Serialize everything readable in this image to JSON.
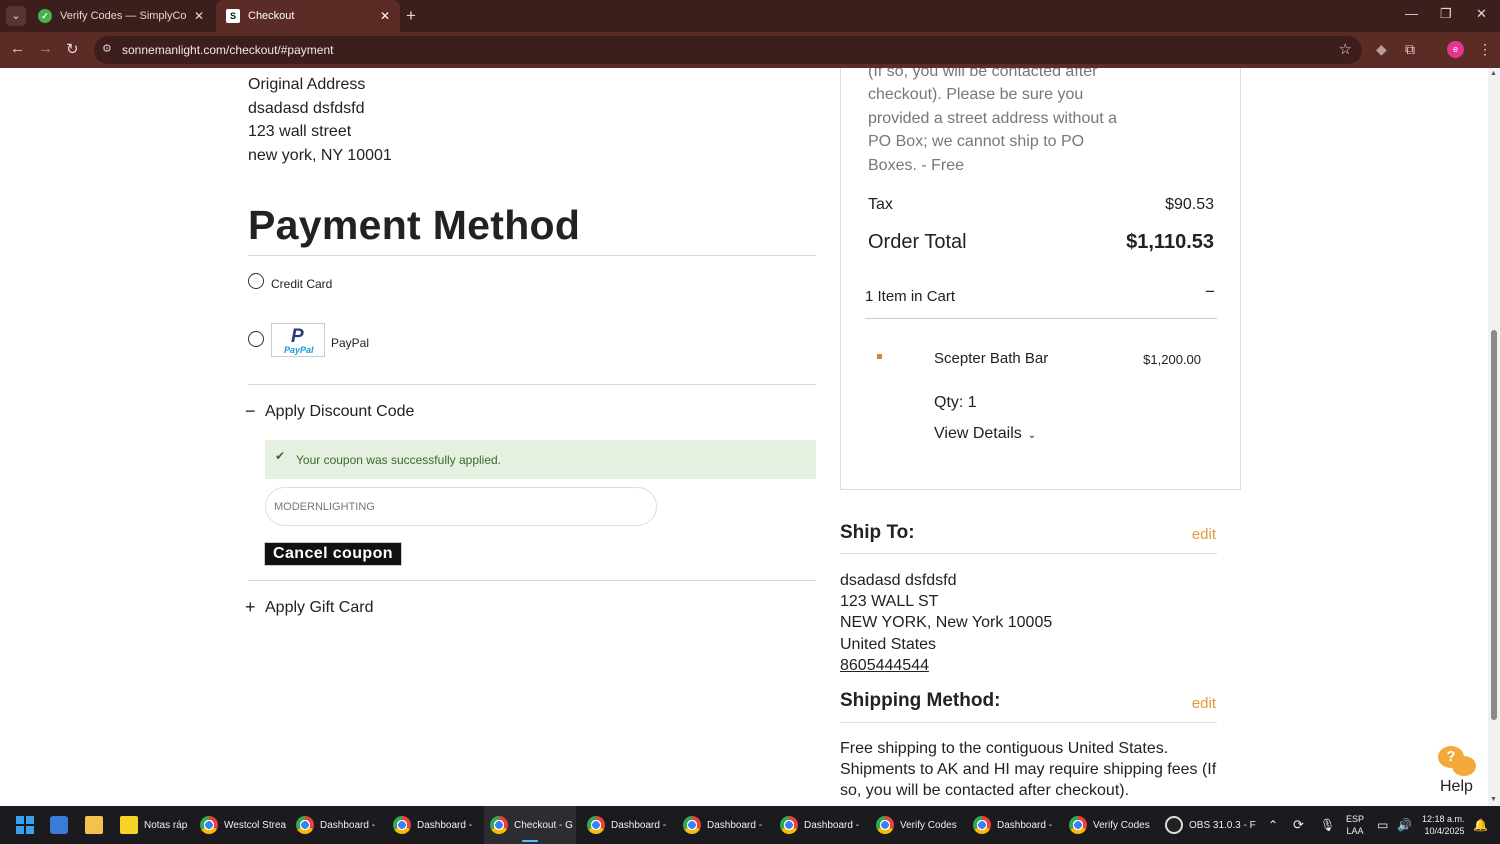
{
  "browser": {
    "tabs": [
      {
        "title": "Verify Codes — SimplyCodes",
        "active": false
      },
      {
        "title": "Checkout",
        "active": true
      }
    ],
    "url": "sonnemanlight.com/checkout/#payment"
  },
  "billing": {
    "heading": "Original Address",
    "name": "dsadasd dsfdsfd",
    "street": "123 wall street",
    "city": "new york, NY 10001"
  },
  "payment": {
    "title": "Payment Method",
    "options": [
      {
        "label": "Credit Card",
        "selected": false
      },
      {
        "label": "PayPal",
        "selected": false,
        "logo_text": "PayPal"
      }
    ],
    "discount": {
      "toggle": "−",
      "label": "Apply Discount Code",
      "success_message": "Your coupon was successfully applied.",
      "code_value": "MODERNLIGHTING",
      "cancel_label": "Cancel coupon"
    },
    "gift_card": {
      "toggle": "+",
      "label": "Apply Gift Card"
    }
  },
  "summary": {
    "shipping_note": "(If so, you will be contacted after checkout). Please be sure you provided a street address without a PO Box; we cannot ship to PO Boxes. - Free",
    "tax_label": "Tax",
    "tax_value": "$90.53",
    "total_label": "Order Total",
    "total_value": "$1,110.53",
    "cart_label": "1 Item in Cart",
    "cart_toggle": "−",
    "item": {
      "name": "Scepter Bath Bar",
      "price": "$1,200.00",
      "qty": "Qty: 1",
      "details_label": "View Details"
    }
  },
  "ship_to": {
    "title": "Ship To:",
    "edit": "edit",
    "name": "dsadasd dsfdsfd",
    "street": "123 WALL ST",
    "city": "NEW YORK, New York 10005",
    "country": "United States",
    "phone": "8605444544"
  },
  "shipping_method": {
    "title": "Shipping Method:",
    "edit": "edit",
    "text": "Free shipping to the contiguous United States. Shipments to AK and HI may require shipping fees (If so, you will be contacted after checkout)."
  },
  "help": {
    "label": "Help"
  },
  "taskbar": {
    "items": [
      {
        "label": "Notas ráp",
        "icon": "notes-icon"
      },
      {
        "label": "Westcol Strea",
        "icon": "chrome-icon"
      },
      {
        "label": "Dashboard - ",
        "icon": "chrome-icon"
      },
      {
        "label": "Dashboard - ",
        "icon": "chrome-icon"
      },
      {
        "label": "Checkout - G",
        "icon": "chrome-icon"
      },
      {
        "label": "Dashboard - ",
        "icon": "chrome-icon"
      },
      {
        "label": "Dashboard - ",
        "icon": "chrome-icon"
      },
      {
        "label": "Dashboard - ",
        "icon": "chrome-icon"
      },
      {
        "label": "Verify Codes ",
        "icon": "chrome-icon"
      },
      {
        "label": "Dashboard - ",
        "icon": "chrome-icon"
      },
      {
        "label": "Verify Codes ",
        "icon": "chrome-icon"
      },
      {
        "label": "OBS 31.0.3 - F",
        "icon": "obs-icon"
      }
    ],
    "lang_top": "ESP",
    "lang_bottom": "LAA",
    "time": "12:18 a.m.",
    "date": "10/4/2025"
  },
  "colors": {
    "accent_link": "#e29a3a",
    "success_bg": "#e5f0e0",
    "chrome_frame": "#5b2c26"
  }
}
